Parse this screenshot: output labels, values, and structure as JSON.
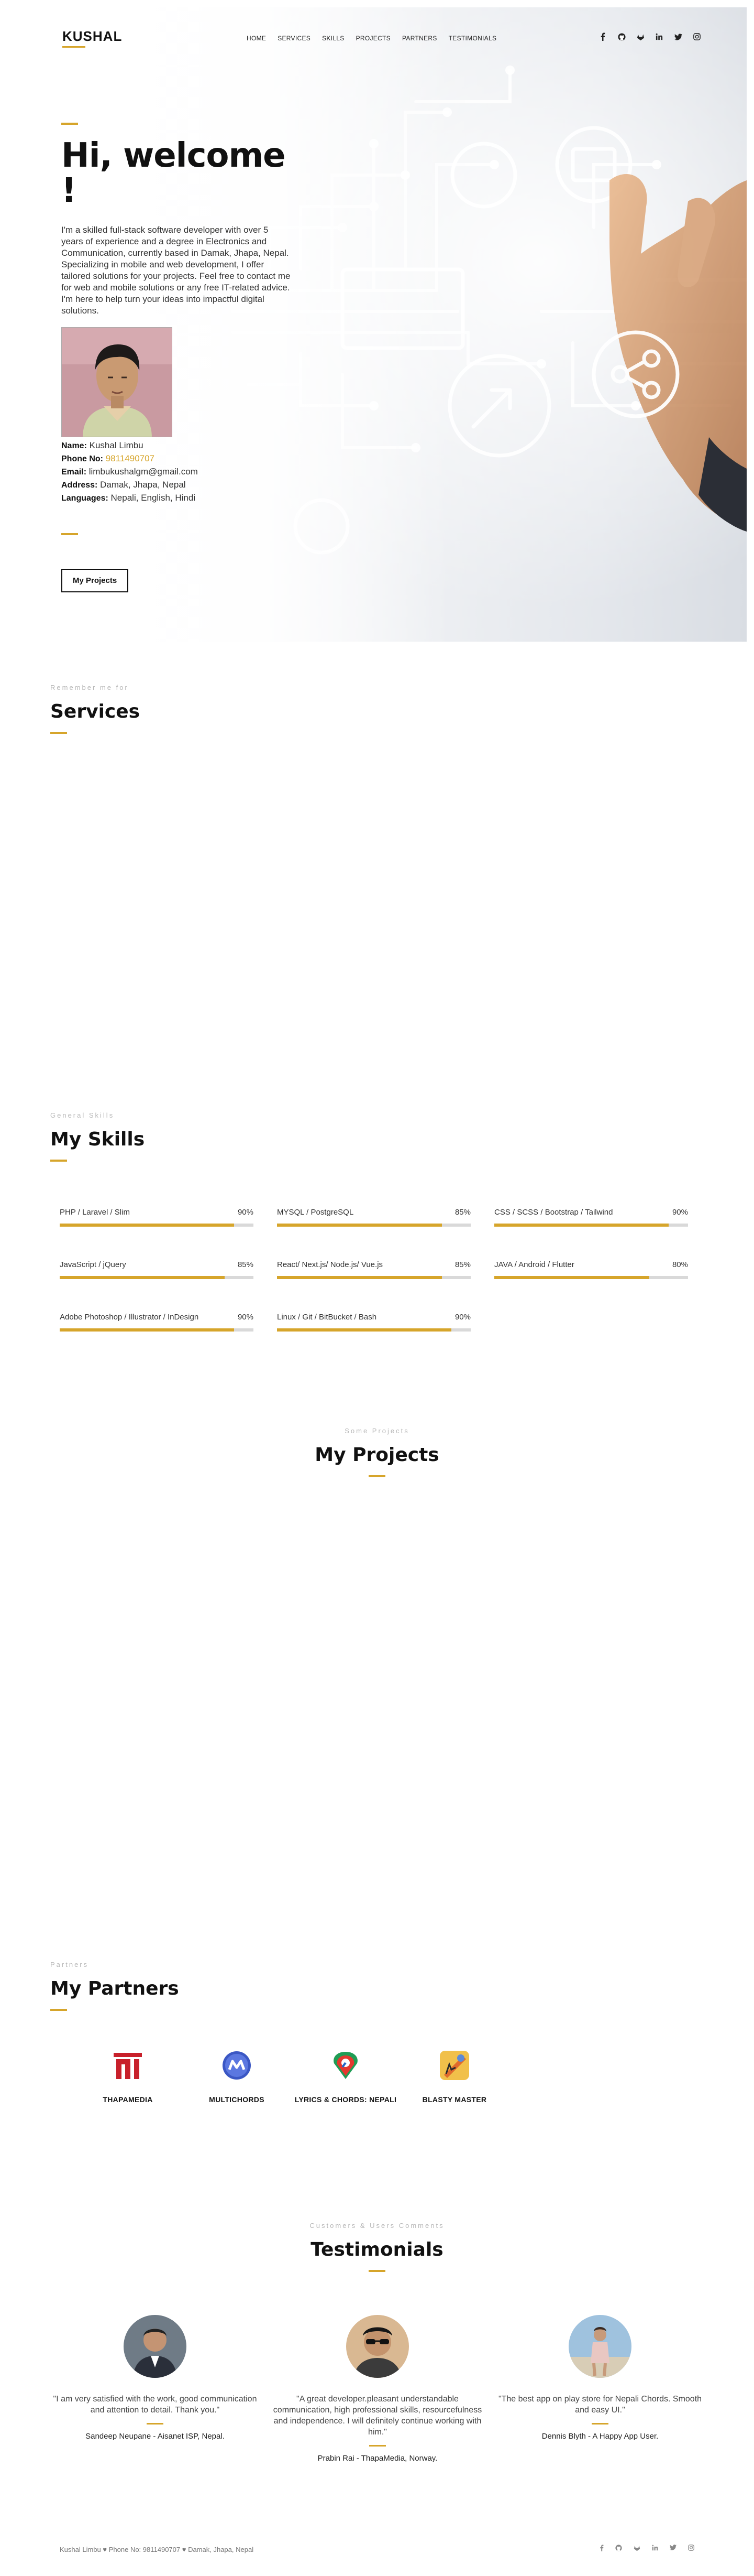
{
  "brand": {
    "logo": "KUSHAL",
    "accent_color": "#d6a52b"
  },
  "nav": {
    "items": [
      "HOME",
      "SERVICES",
      "SKILLS",
      "PROJECTS",
      "PARTNERS",
      "TESTIMONIALS"
    ],
    "social_icons": [
      "facebook-icon",
      "github-icon",
      "gitlab-icon",
      "linkedin-icon",
      "twitter-icon",
      "instagram-icon"
    ]
  },
  "hero": {
    "title": "Hi, welcome !",
    "description": " I'm a skilled full-stack software developer with over 5 years of experience and a degree in Electronics and Communication, currently based in Damak, Jhapa, Nepal. Specializing in mobile and web development, I offer tailored solutions for your projects. Feel free to contact me for web and mobile solutions or any free IT-related advice. I'm here to help turn your ideas into impactful digital solutions.",
    "info": {
      "name_label": "Name:",
      "name": " Kushal Limbu",
      "phone_label": "Phone No:",
      "phone": " 9811490707",
      "email_label": "Email:",
      "email": " limbukushalgm@gmail.com",
      "address_label": "Address:",
      "address": " Damak, Jhapa, Nepal",
      "languages_label": "Languages:",
      "languages": " Nepali, English, Hindi"
    },
    "button": "My Projects"
  },
  "services": {
    "eyebrow": "Remember me for",
    "title": "Services"
  },
  "skills": {
    "eyebrow": "General Skills",
    "title": "My Skills",
    "items": [
      {
        "name": "PHP / Laravel / Slim",
        "percent_label": "90%",
        "level": 0.9
      },
      {
        "name": "MYSQL / PostgreSQL",
        "percent_label": "85%",
        "level": 0.85
      },
      {
        "name": "CSS / SCSS / Bootstrap / Tailwind",
        "percent_label": "90%",
        "level": 0.9
      },
      {
        "name": "JavaScript / jQuery",
        "percent_label": "85%",
        "level": 0.85
      },
      {
        "name": "React/ Next.js/ Node.js/ Vue.js",
        "percent_label": "85%",
        "level": 0.85
      },
      {
        "name": "JAVA / Android / Flutter",
        "percent_label": "80%",
        "level": 0.8
      },
      {
        "name": "Adobe Photoshop / Illustrator / InDesign",
        "percent_label": "90%",
        "level": 0.9
      },
      {
        "name": "Linux / Git / BitBucket / Bash",
        "percent_label": "90%",
        "level": 0.9
      }
    ]
  },
  "projects": {
    "eyebrow": "Some Projects",
    "title": "My Projects"
  },
  "partners": {
    "eyebrow": "Partners",
    "title": "My Partners",
    "items": [
      {
        "name": "THAPAMEDIA",
        "icon": "thapamedia-logo"
      },
      {
        "name": "MULTICHORDS",
        "icon": "multichords-logo"
      },
      {
        "name": "LYRICS & CHORDS: NEPALI",
        "icon": "lyrics-chords-logo"
      },
      {
        "name": "BLASTY MASTER",
        "icon": "blasty-master-logo"
      }
    ]
  },
  "testimonials": {
    "eyebrow": "Customers & Users Comments",
    "title": "Testimonials",
    "items": [
      {
        "quote": "\"I am very satisfied with the work, good communication and attention to detail. Thank you.\"",
        "author": "Sandeep Neupane - Aisanet ISP, Nepal."
      },
      {
        "quote": "\"A great developer.pleasant understandable communication, high professional skills, resourcefulness and independence. I will definitely continue working with him.\"",
        "author": "Prabin Rai - ThapaMedia, Norway."
      },
      {
        "quote": "\"The best app on play store for Nepali Chords. Smooth and easy UI.\"",
        "author": "Dennis Blyth - A Happy App User."
      }
    ]
  },
  "footer": {
    "name": "Kushal Limbu",
    "phone": " Phone No: 9811490707 ",
    "address": " Damak, Jhapa, Nepal"
  }
}
